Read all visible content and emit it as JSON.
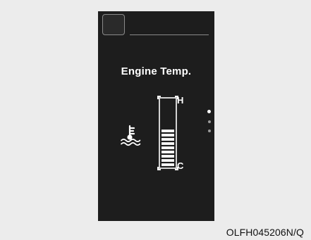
{
  "screen": {
    "title": "Engine Temp.",
    "gauge": {
      "high_label": "H",
      "low_label": "C",
      "level_fraction": 0.55,
      "segments_total": 16,
      "segments_filled": 9
    }
  },
  "footer": {
    "figure_code": "OLFH045206N/Q"
  },
  "colors": {
    "background": "#ececec",
    "screen": "#1d1d1d",
    "foreground": "#ffffff",
    "muted": "#8a8a8a"
  },
  "icons": {
    "temperature": "coolant-temperature-icon"
  }
}
